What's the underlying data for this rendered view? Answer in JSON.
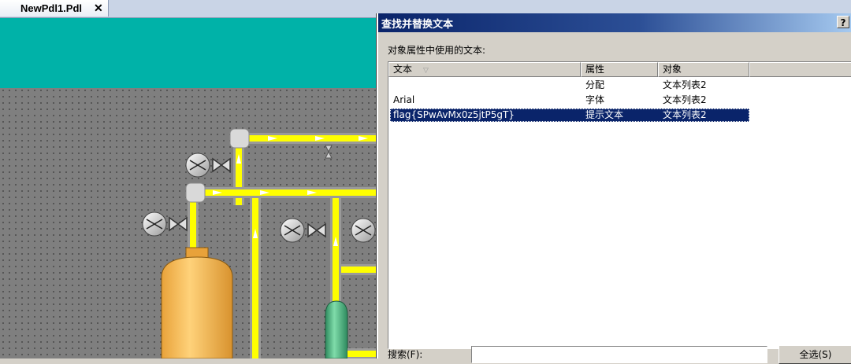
{
  "tab": {
    "label": "NewPdl1.Pdl",
    "close_glyph": "✕"
  },
  "dialog": {
    "title": "查找并替换文本",
    "help_label": "?",
    "object_text_label": "对象属性中使用的文本:",
    "columns": [
      {
        "label": "文本",
        "sort_glyph": "▽"
      },
      {
        "label": "属性"
      },
      {
        "label": "对象"
      }
    ],
    "rows": [
      {
        "text": "",
        "property": "分配",
        "object": "文本列表2"
      },
      {
        "text": "Arial",
        "property": "字体",
        "object": "文本列表2"
      },
      {
        "text": "flag{SPwAvMx0z5jtP5gT}",
        "property": "提示文本",
        "object": "文本列表2",
        "selected": true
      }
    ],
    "search_label": "搜索(F):",
    "search_value": "",
    "select_all_label": "全选(S)"
  },
  "colors": {
    "teal_banner": "#00b2a8",
    "pipe_yellow": "#ffff00",
    "tank_orange": "#f0b848",
    "vessel_green": "#3fa878",
    "title_blue": "#0a246a"
  },
  "icons": [
    "close-icon",
    "help-icon",
    "sort-icon",
    "pump-icon",
    "valve-icon",
    "tank",
    "vessel"
  ]
}
